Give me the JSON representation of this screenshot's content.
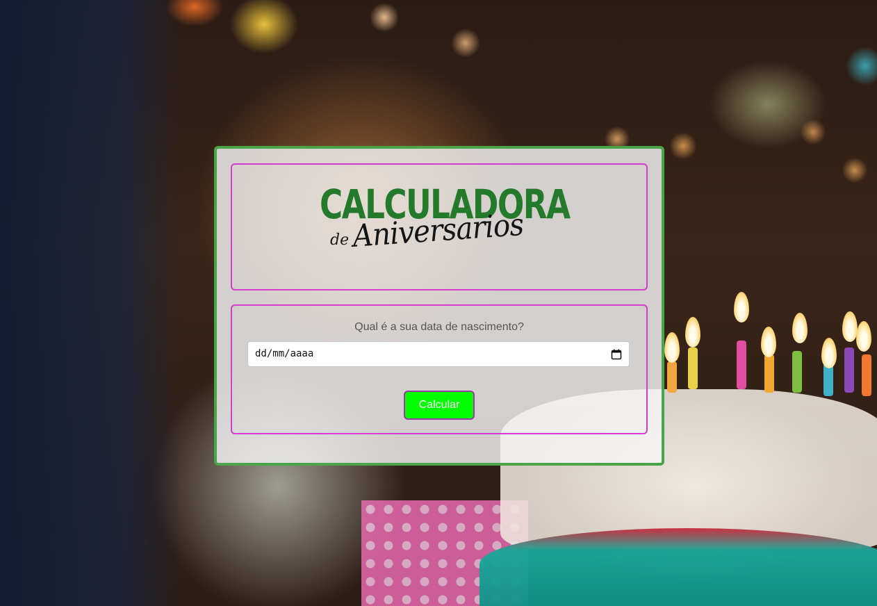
{
  "logo": {
    "title": "CALCULADORA",
    "de": "de",
    "subtitle": "Aniversarios"
  },
  "form": {
    "question": "Qual é a sua data de nascimento?",
    "date_value": "dd/mm/aaaa",
    "date_icon": "calendar-icon",
    "button_label": "Calcular"
  },
  "colors": {
    "card_border": "#4aa44a",
    "box_border": "#d63bd0",
    "logo_green": "#237a2a",
    "button_bg": "#00ff00",
    "button_border": "#9a3aa6"
  }
}
